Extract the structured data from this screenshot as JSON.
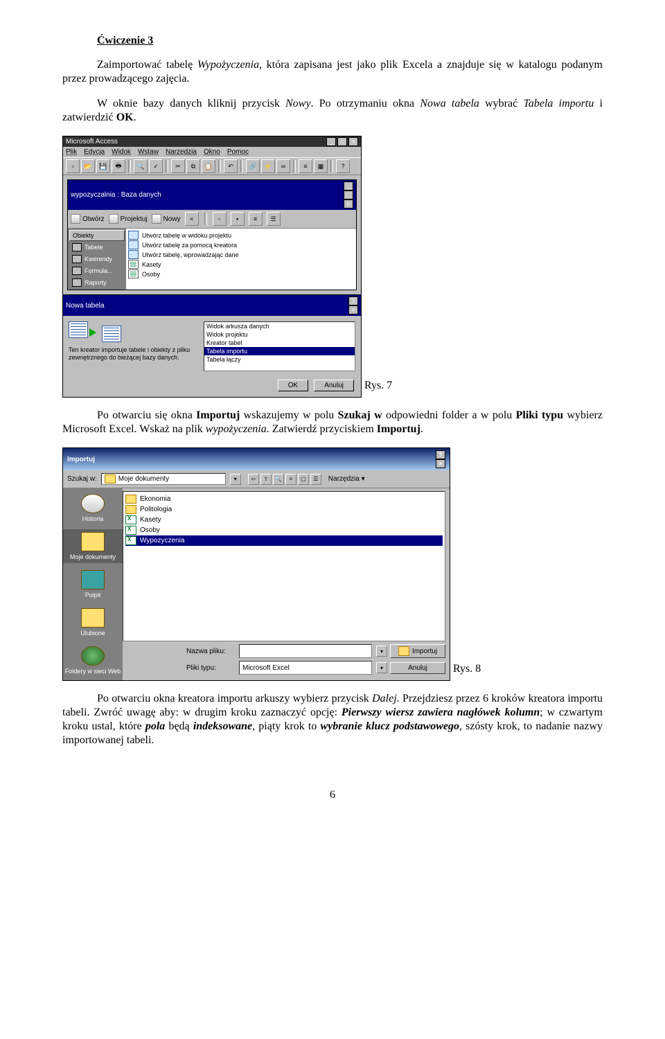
{
  "heading": "Ćwiczenie 3",
  "p1_a": "Zaimportować tabelę ",
  "p1_i": "Wypożyczenia",
  "p1_b": ", która zapisana jest jako plik Excela a znajduje się w katalogu podanym przez prowadzącego zajęcia.",
  "p2_a": "W oknie bazy danych kliknij przycisk ",
  "p2_i": "Nowy",
  "p2_b": ". Po otrzymaniu okna ",
  "p2_i2": "Nowa tabela",
  "p2_c": " wybrać ",
  "p2_i3": "Tabela importu",
  "p2_d": " i zatwierdzić ",
  "p2_b2": "OK",
  "p2_e": ".",
  "fig7_caption": "Rys. 7",
  "p3_a": "Po otwarciu się okna ",
  "p3_b1": "Importuj",
  "p3_b": " wskazujemy w polu ",
  "p3_b2": "Szukaj w",
  "p3_c": "  odpowiedni folder a w polu ",
  "p3_b3": "Pliki typu",
  "p3_d": " wybierz Microsoft Excel. Wskaż na plik ",
  "p3_i": "wypożyczenia",
  "p3_e": ". Zatwierdź przyciskiem ",
  "p3_b4": "Importuj",
  "p3_f": ".",
  "fig8_caption": "Rys. 8",
  "p4_a": "Po otwarciu okna kreatora importu arkuszy wybierz przycisk ",
  "p4_i1": "Dalej",
  "p4_b": ". Przejdziesz przez 6 kroków kreatora importu tabeli. Zwróć uwagę aby: w drugim kroku zaznaczyć opcję: ",
  "p4_bi1": "Pierwszy wiersz zawiera nagłówek kolumn",
  "p4_c": "; w czwartym kroku ustal, które ",
  "p4_bi2": "pola",
  "p4_d": " będą ",
  "p4_bi3": "indeksowane",
  "p4_e": ", piąty krok to ",
  "p4_bi4": "wybranie klucz podstawowego",
  "p4_f": ", szósty krok, to nadanie nazwy importowanej tabeli.",
  "pagenum": "6",
  "shot1": {
    "app_title": "Microsoft Access",
    "menus": [
      "Plik",
      "Edycja",
      "Widok",
      "Wstaw",
      "Narzędzia",
      "Okno",
      "Pomoc"
    ],
    "db_title": "wypozyczalnia : Baza danych",
    "db_buttons": {
      "open": "Otwórz",
      "design": "Projektuj",
      "new": "Nowy"
    },
    "side_header": "Obiekty",
    "side_items": [
      "Tabele",
      "Kwerendy",
      "Formula...",
      "Raporty"
    ],
    "list_items": [
      "Utwórz tabelę w widoku projektu",
      "Utwórz tabelę za pomocą kreatora",
      "Utwórz tabelę, wprowadzając dane",
      "Kasety",
      "Osoby"
    ],
    "dlg_title": "Nowa tabela",
    "dlg_desc": "Ten kreator importuje tabele i obiekty z pliku zewnętrznego do bieżącej bazy danych.",
    "dlg_options": [
      "Widok arkusza danych",
      "Widok projektu",
      "Kreator tabel",
      "Tabela importu",
      "Tabela łączy"
    ],
    "dlg_selected_index": 3,
    "ok": "OK",
    "cancel": "Anuluj"
  },
  "shot2": {
    "title": "Importuj",
    "lookin_label": "Szukaj w:",
    "lookin_value": "Moje dokumenty",
    "tools_label": "Narzędzia",
    "places": [
      "Historia",
      "Moje dokumenty",
      "Pulpit",
      "Ulubione",
      "Foldery w sieci Web"
    ],
    "files": [
      {
        "name": "Ekonomia",
        "type": "folder"
      },
      {
        "name": "Politologia",
        "type": "folder"
      },
      {
        "name": "Kasety",
        "type": "xls"
      },
      {
        "name": "Osoby",
        "type": "xls"
      },
      {
        "name": "Wypozyczenia",
        "type": "xls",
        "selected": true
      }
    ],
    "filename_label": "Nazwa pliku:",
    "filetype_label": "Pliki typu:",
    "filetype_value": "Microsoft Excel",
    "import_btn": "Importuj",
    "cancel_btn": "Anuluj"
  }
}
